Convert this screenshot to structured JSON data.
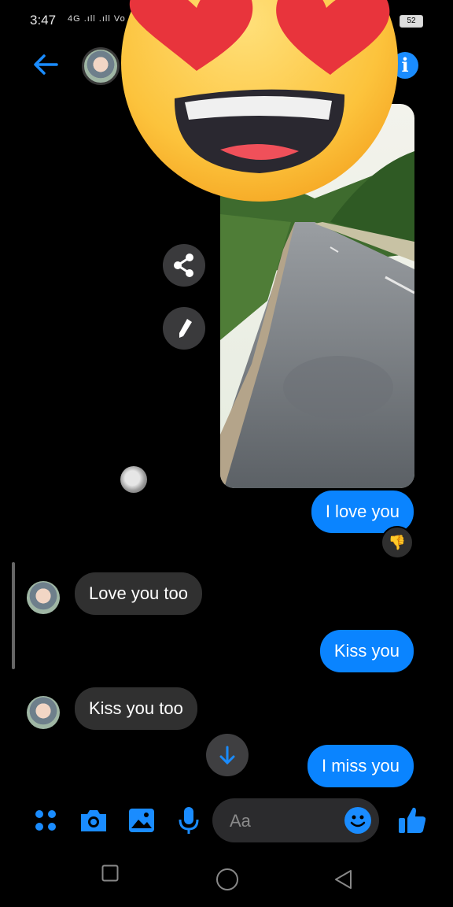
{
  "status_bar": {
    "time": "3:47",
    "signal_text": "4G .ıll .ıll Vo LTE",
    "battery": "52"
  },
  "messages": [
    {
      "side": "out",
      "text": "I love you"
    },
    {
      "side": "in",
      "text": "Love you too"
    },
    {
      "side": "out",
      "text": "Kiss you"
    },
    {
      "side": "in",
      "text": "Kiss you too"
    },
    {
      "side": "out",
      "text": "I miss you"
    }
  ],
  "reaction": "👎",
  "composer": {
    "placeholder": "Aa"
  },
  "colors": {
    "accent": "#0a84ff",
    "bubble_in": "#303030",
    "background": "#000000"
  },
  "icons": [
    "back-arrow-icon",
    "info-icon",
    "share-icon",
    "pencil-icon",
    "apps-icon",
    "camera-icon",
    "gallery-icon",
    "microphone-icon",
    "emoji-icon",
    "thumbs-up-icon",
    "arrow-down-icon",
    "recent-apps-icon",
    "home-icon",
    "back-triangle-icon"
  ]
}
